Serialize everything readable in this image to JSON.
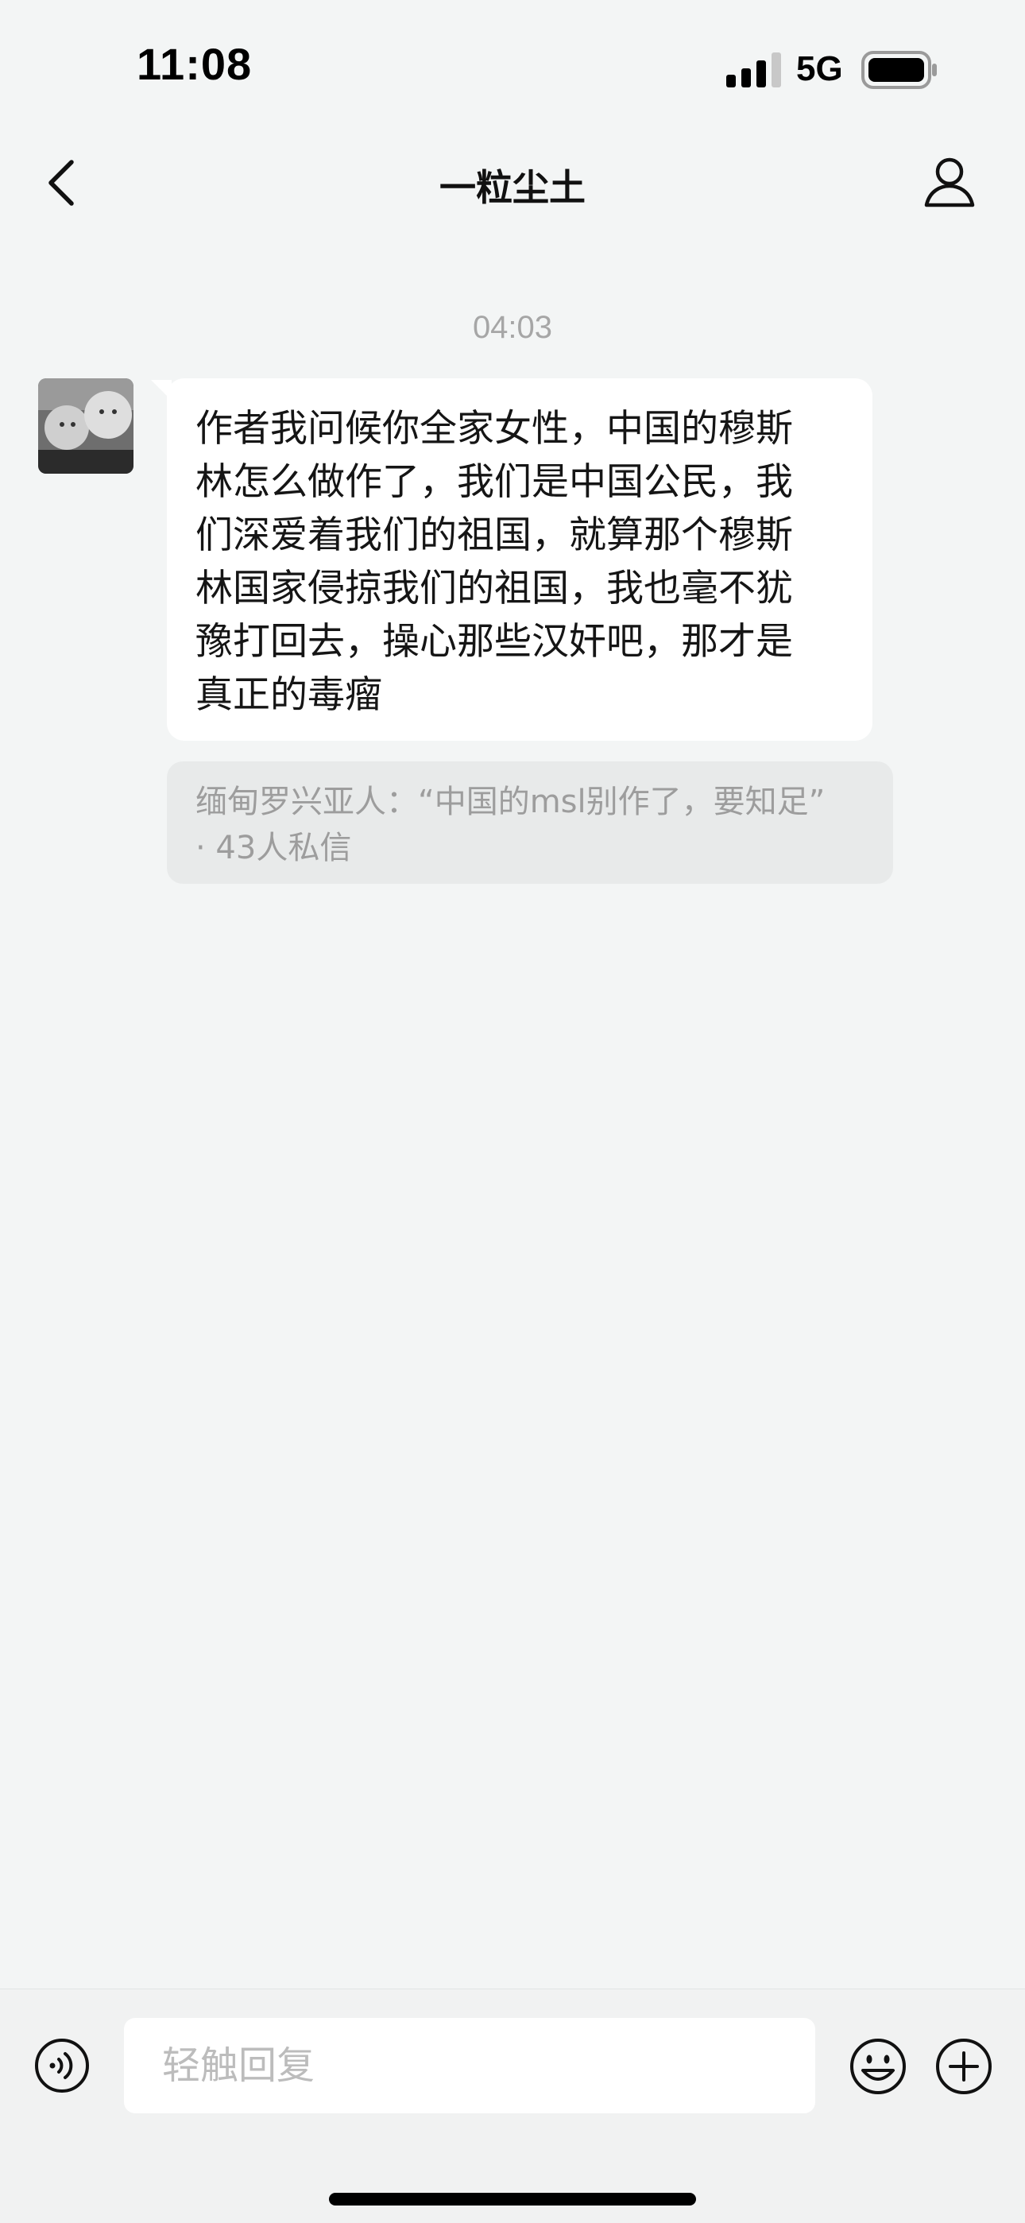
{
  "status_bar": {
    "time": "11:08",
    "network": "5G",
    "signal_icon": "cellular-signal-icon",
    "battery_icon": "battery-full-icon"
  },
  "nav": {
    "title": "一粒尘土",
    "back_icon": "chevron-left-icon",
    "profile_icon": "person-outline-icon"
  },
  "chat": {
    "timestamp": "04:03",
    "message": {
      "lines": [
        "作者我问候你全家女性，中国的穆斯",
        "林怎么做作了，我们是中国公民，我",
        "们深爱着我们的祖国，就算那个穆斯",
        "林国家侵掠我们的祖国，我也毫不犹",
        "豫打回去，操心那些汉奸吧，那才是",
        "真正的毒瘤"
      ]
    },
    "context_card": {
      "line1": "缅甸罗兴亚人：“中国的msl别作了，要知足”",
      "line2": "· 43人私信"
    }
  },
  "input_bar": {
    "placeholder": "轻触回复",
    "voice_icon": "voice-input-icon",
    "emoji_icon": "emoji-smile-icon",
    "plus_icon": "plus-circle-icon"
  },
  "colors": {
    "background": "#f3f5f5",
    "bubble": "#ffffff",
    "context_card": "#e8eaea",
    "muted_text": "#9d9d9d"
  }
}
